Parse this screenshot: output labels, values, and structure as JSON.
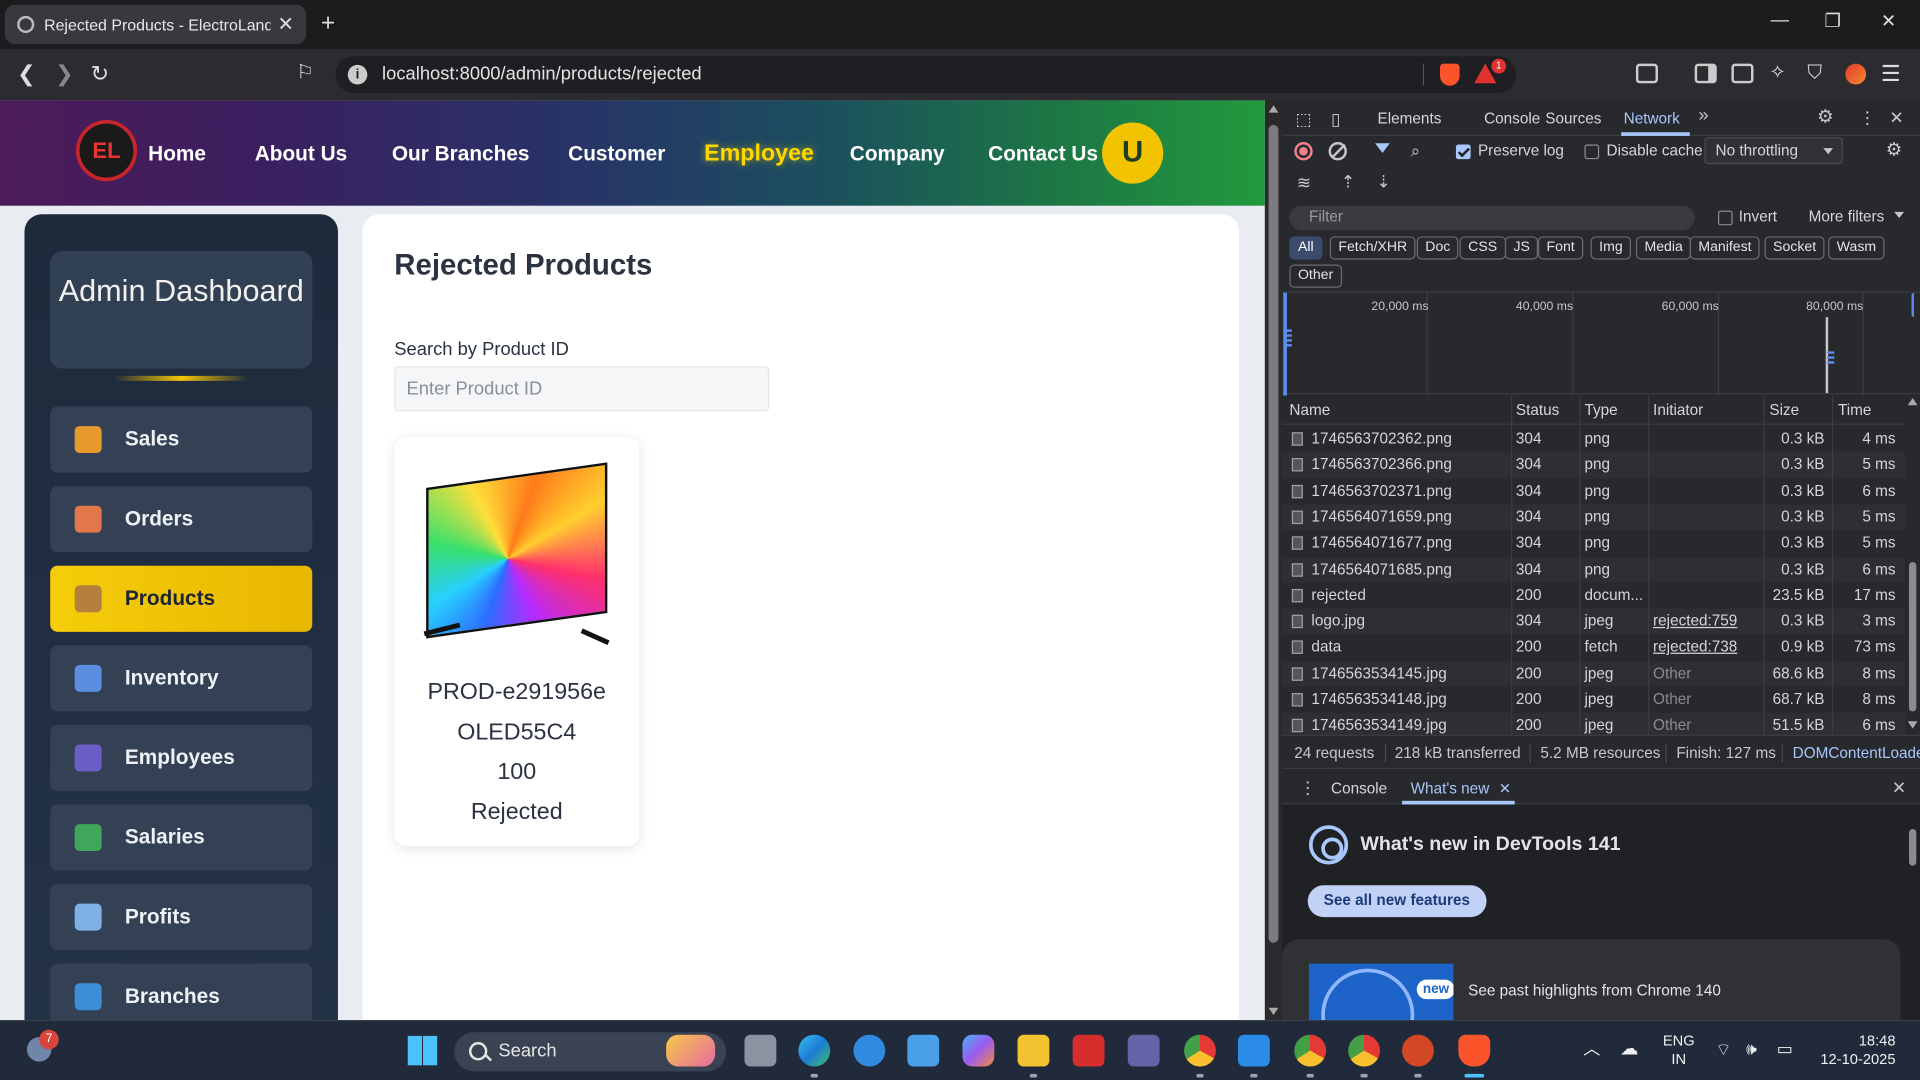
{
  "browser": {
    "tab_title": "Rejected Products - ElectroLand",
    "url": "localhost:8000/admin/products/rejected",
    "notification_badge": "1"
  },
  "site": {
    "logo_text": "EL",
    "nav": [
      "Home",
      "About Us",
      "Our Branches",
      "Customer",
      "Employee",
      "Company",
      "Contact Us"
    ],
    "active_nav": "Employee",
    "avatar_letter": "U"
  },
  "sidebar": {
    "title": "Admin Dashboard",
    "items": [
      {
        "label": "Sales",
        "icon": "money-bag-icon",
        "color": "#e69a2e"
      },
      {
        "label": "Orders",
        "icon": "clipboard-icon",
        "color": "#e2774a"
      },
      {
        "label": "Products",
        "icon": "package-icon",
        "color": "#b5803d",
        "active": true
      },
      {
        "label": "Inventory",
        "icon": "buildings-icon",
        "color": "#5b8de0"
      },
      {
        "label": "Employees",
        "icon": "people-icon",
        "color": "#6b5ec7"
      },
      {
        "label": "Salaries",
        "icon": "money-wings-icon",
        "color": "#3fa65a"
      },
      {
        "label": "Profits",
        "icon": "chart-up-icon",
        "color": "#7fb1e6"
      },
      {
        "label": "Branches",
        "icon": "globe-icon",
        "color": "#3b8fd6"
      }
    ]
  },
  "main": {
    "title": "Rejected Products",
    "search_label": "Search by Product ID",
    "search_placeholder": "Enter Product ID",
    "product": {
      "id": "PROD-e291956e",
      "name": "OLED55C4",
      "quantity": "100",
      "status": "Rejected"
    }
  },
  "devtools": {
    "tabs": [
      "Elements",
      "Console",
      "Sources",
      "Network"
    ],
    "active_tab": "Network",
    "preserve_log": "Preserve log",
    "preserve_log_checked": true,
    "disable_cache": "Disable cache",
    "disable_cache_checked": false,
    "throttling": "No throttling",
    "filter_placeholder": "Filter",
    "invert": "Invert",
    "more_filters": "More filters",
    "type_filters": [
      "All",
      "Fetch/XHR",
      "Doc",
      "CSS",
      "JS",
      "Font",
      "Img",
      "Media",
      "Manifest",
      "Socket",
      "Wasm",
      "Other"
    ],
    "timeline_labels": [
      "20,000 ms",
      "40,000 ms",
      "60,000 ms",
      "80,000 ms"
    ],
    "columns": [
      "Name",
      "Status",
      "Type",
      "Initiator",
      "Size",
      "Time"
    ],
    "rows": [
      {
        "name": "1746563702362.png",
        "status": "304",
        "type": "png",
        "initiator": "",
        "size": "0.3 kB",
        "time": "4 ms"
      },
      {
        "name": "1746563702366.png",
        "status": "304",
        "type": "png",
        "initiator": "",
        "size": "0.3 kB",
        "time": "5 ms"
      },
      {
        "name": "1746563702371.png",
        "status": "304",
        "type": "png",
        "initiator": "",
        "size": "0.3 kB",
        "time": "6 ms"
      },
      {
        "name": "1746564071659.png",
        "status": "304",
        "type": "png",
        "initiator": "",
        "size": "0.3 kB",
        "time": "5 ms"
      },
      {
        "name": "1746564071677.png",
        "status": "304",
        "type": "png",
        "initiator": "",
        "size": "0.3 kB",
        "time": "5 ms"
      },
      {
        "name": "1746564071685.png",
        "status": "304",
        "type": "png",
        "initiator": "",
        "size": "0.3 kB",
        "time": "6 ms"
      },
      {
        "name": "rejected",
        "status": "200",
        "type": "docum...",
        "initiator": "",
        "size": "23.5 kB",
        "time": "17 ms"
      },
      {
        "name": "logo.jpg",
        "status": "304",
        "type": "jpeg",
        "initiator": "rejected:759",
        "size": "0.3 kB",
        "time": "3 ms"
      },
      {
        "name": "data",
        "status": "200",
        "type": "fetch",
        "initiator": "rejected:738",
        "size": "0.9 kB",
        "time": "73 ms"
      },
      {
        "name": "1746563534145.jpg",
        "status": "200",
        "type": "jpeg",
        "initiator": "Other",
        "size": "68.6 kB",
        "time": "8 ms"
      },
      {
        "name": "1746563534148.jpg",
        "status": "200",
        "type": "jpeg",
        "initiator": "Other",
        "size": "68.7 kB",
        "time": "8 ms"
      },
      {
        "name": "1746563534149.jpg",
        "status": "200",
        "type": "jpeg",
        "initiator": "Other",
        "size": "51.5 kB",
        "time": "6 ms"
      }
    ],
    "status_bar": {
      "requests": "24 requests",
      "transferred": "218 kB transferred",
      "resources": "5.2 MB resources",
      "finish": "Finish: 127 ms",
      "dcl": "DOMContentLoaded"
    },
    "drawer_tabs": [
      "Console",
      "What's new"
    ],
    "whats_new_title": "What's new in DevTools 141",
    "see_all": "See all new features",
    "promo_badge": "new",
    "promo_text": "See past highlights from Chrome 140"
  },
  "taskbar": {
    "weather_badge": "7",
    "search_label": "Search",
    "lang": "ENG",
    "region": "IN",
    "time": "18:48",
    "date": "12-10-2025"
  }
}
